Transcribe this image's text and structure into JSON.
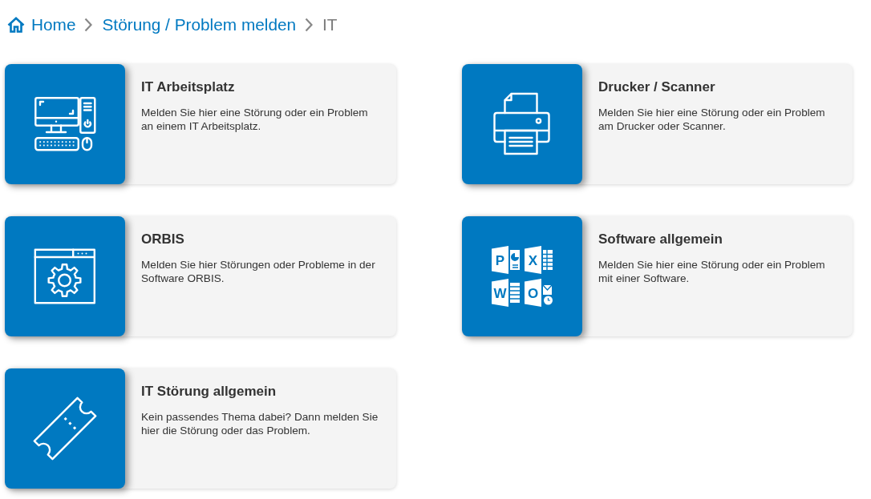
{
  "breadcrumb": [
    {
      "label": "Home",
      "current": false
    },
    {
      "label": "Störung / Problem melden",
      "current": false
    },
    {
      "label": "IT",
      "current": true
    }
  ],
  "cards": [
    {
      "title": "IT Arbeitsplatz",
      "description": "Melden Sie hier eine Störung oder ein Problem an einem IT Arbeitsplatz."
    },
    {
      "title": "Drucker / Scanner",
      "description": "Melden Sie hier eine Störung oder ein Problem am Drucker oder Scanner."
    },
    {
      "title": "ORBIS",
      "description": "Melden Sie hier Störungen oder Probleme in der Software ORBIS."
    },
    {
      "title": "Software allgemein",
      "description": "Melden Sie hier eine Störung oder ein Problem mit einer Software.",
      "app_logos": [
        "P",
        "X",
        "W",
        "O"
      ]
    },
    {
      "title": "IT Störung allgemein",
      "description": "Kein passendes Thema dabei? Dann melden Sie hier die Störung oder das Problem."
    }
  ]
}
